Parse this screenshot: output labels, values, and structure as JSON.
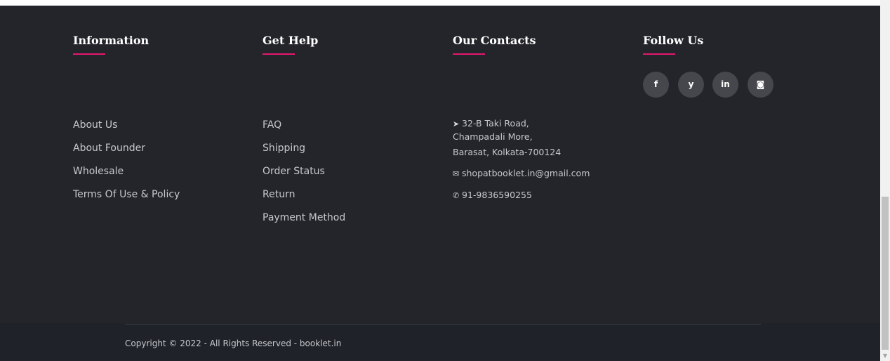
{
  "information": {
    "heading": "Information",
    "links": [
      "About Us",
      "About Founder",
      "Wholesale",
      "Terms Of Use & Policy"
    ]
  },
  "get_help": {
    "heading": "Get Help",
    "links": [
      "FAQ",
      "Shipping",
      "Order Status",
      "Return",
      "Payment Method"
    ]
  },
  "contacts": {
    "heading": "Our Contacts",
    "address_line1": "32-B Taki Road,",
    "address_line2": "Champadali More,",
    "address_line3": "Barasat, Kolkata-700124",
    "email": "shopatbooklet.in@gmail.com",
    "phone": "91-9836590255",
    "icons": [
      "location-arrow-icon",
      "envelope-icon",
      "phone-icon"
    ]
  },
  "follow": {
    "heading": "Follow Us",
    "social": [
      {
        "label": "f",
        "icon": "facebook-icon"
      },
      {
        "label": "y",
        "icon": "twitter-icon"
      },
      {
        "label": "in",
        "icon": "linkedin-icon"
      },
      {
        "label": "◙",
        "icon": "instagram-icon"
      }
    ]
  },
  "footer": {
    "copyright": "Copyright © 2022 - All Rights Reserved - booklet.in"
  },
  "colors": {
    "background": "#24252a",
    "accent": "#e4186e",
    "bottom_bar": "#1f2228"
  }
}
